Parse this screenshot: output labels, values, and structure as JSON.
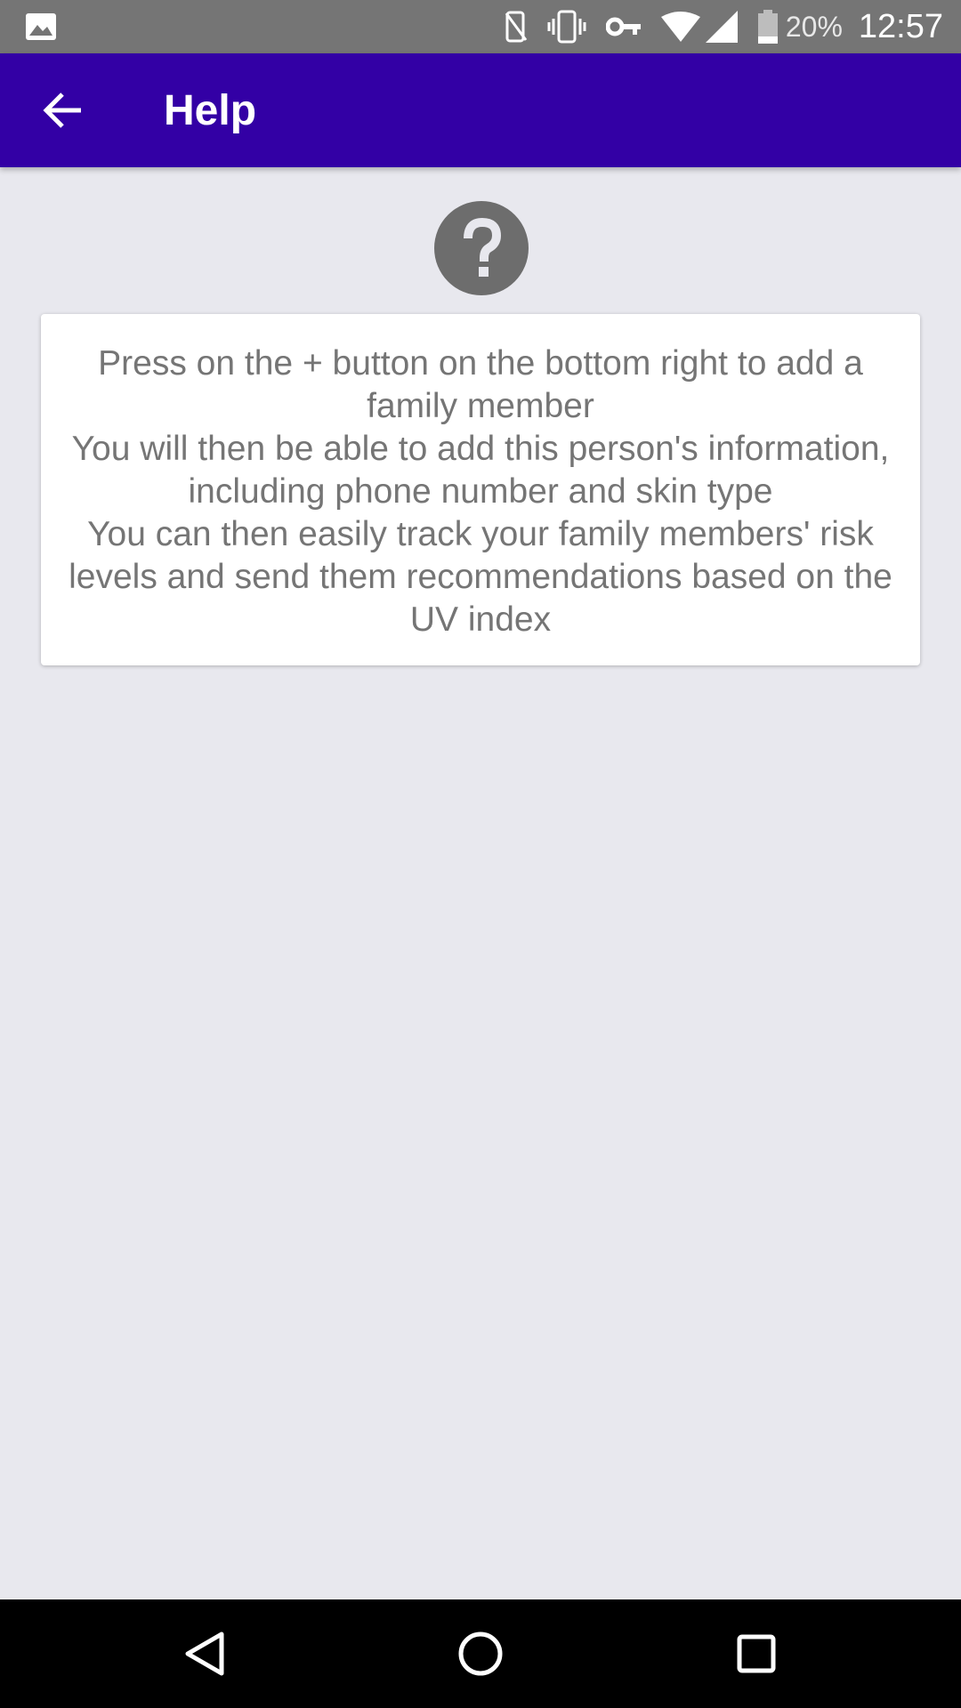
{
  "status_bar": {
    "icons": [
      "gallery-icon",
      "nfc-icon",
      "vibrate-icon",
      "vpn-key-icon",
      "wifi-icon",
      "cell-signal-icon",
      "battery-icon"
    ],
    "battery": "20%",
    "time": "12:57"
  },
  "app_bar": {
    "title": "Help",
    "background": "#3300a5"
  },
  "help": {
    "icon": "help-circle-icon",
    "lines": [
      "Press on the + button on the bottom right to add a family member",
      "You will then be able to add this person's information, including phone number and skin type",
      "You can then easily track your family members' risk levels and send them recommendations based on the UV index"
    ]
  },
  "nav_bar": {
    "buttons": [
      "back-nav-icon",
      "home-nav-icon",
      "recents-nav-icon"
    ]
  }
}
